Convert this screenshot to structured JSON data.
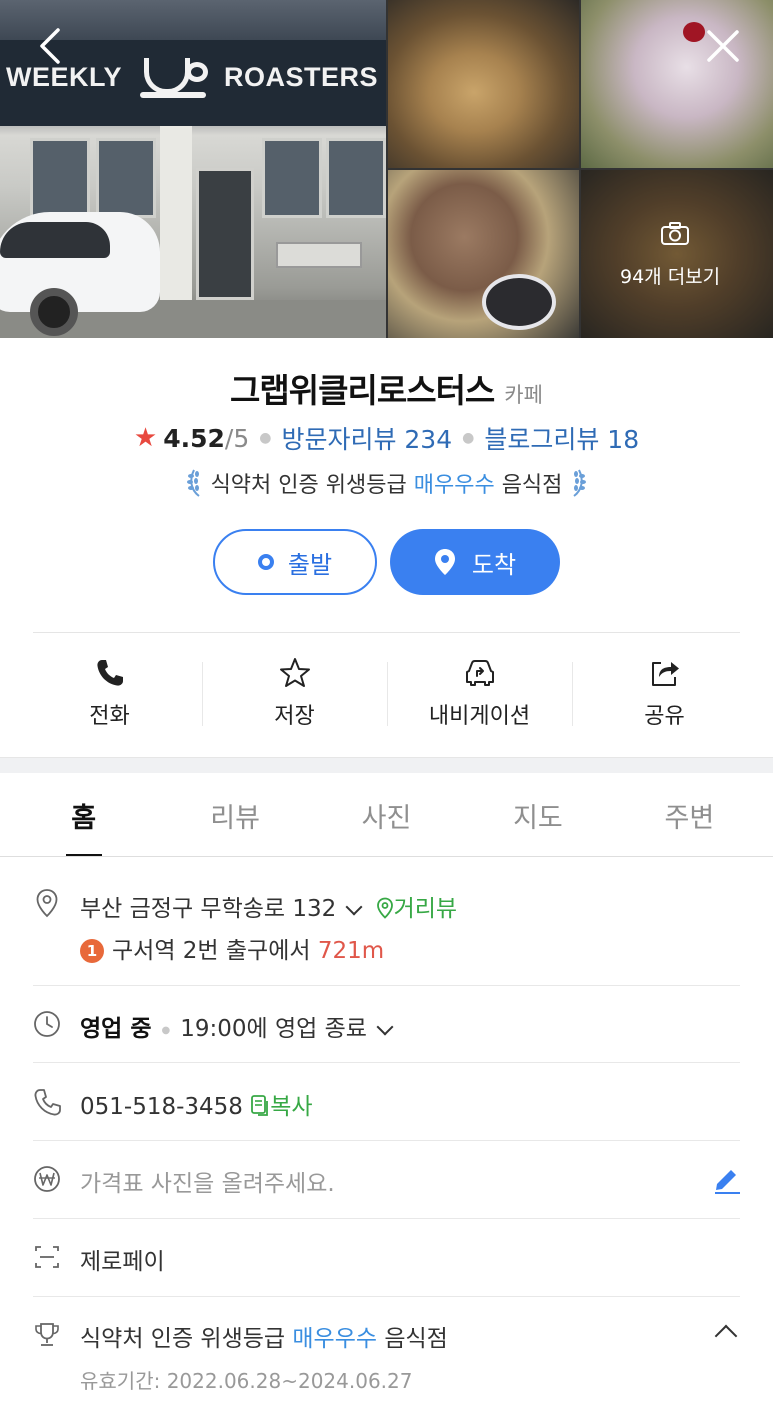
{
  "photos": {
    "storefront_sign_left": "WEEKLY",
    "storefront_sign_right": "ROASTERS",
    "more_label": "94개 더보기"
  },
  "place": {
    "name": "그랩위클리로스터스",
    "category": "카페",
    "rating": "4.52",
    "rating_max": "/5",
    "visitor_reviews": "방문자리뷰 234",
    "blog_reviews": "블로그리뷰 18"
  },
  "hygiene": {
    "prefix": "식약처 인증 위생등급",
    "grade": "매우우수",
    "suffix": "음식점"
  },
  "route": {
    "depart_label": "출발",
    "arrive_label": "도착"
  },
  "actions": [
    {
      "label": "전화",
      "icon": "phone-icon"
    },
    {
      "label": "저장",
      "icon": "star-outline-icon"
    },
    {
      "label": "내비게이션",
      "icon": "car-navigation-icon"
    },
    {
      "label": "공유",
      "icon": "share-icon"
    }
  ],
  "tabs": [
    "홈",
    "리뷰",
    "사진",
    "지도",
    "주변"
  ],
  "address": {
    "text": "부산 금정구 무학송로 132",
    "streetview_label": "거리뷰",
    "subway_line": "1",
    "subway_prefix": "구서역 2번 출구에서",
    "subway_distance": "721m"
  },
  "hours": {
    "status": "영업 중",
    "detail": "19:00에 영업 종료"
  },
  "phone": {
    "number": "051-518-3458",
    "copy_label": "복사"
  },
  "price": {
    "placeholder": "가격표 사진을 올려주세요."
  },
  "zeropay": {
    "label": "제로페이"
  },
  "certification": {
    "prefix": "식약처 인증 위생등급",
    "grade": "매우우수",
    "suffix": "음식점",
    "valid_period": "유효기간: 2022.06.28~2024.06.27"
  },
  "colors": {
    "accent_blue": "#3a80f0",
    "link_blue": "#2f6bb5",
    "green": "#37a845",
    "red": "#e0574a",
    "star": "#e8493f"
  }
}
